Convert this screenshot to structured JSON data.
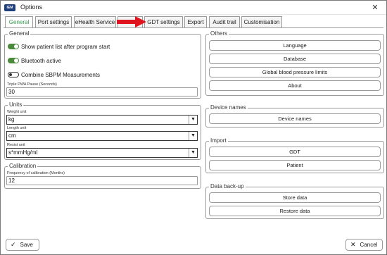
{
  "window": {
    "logo_text": "IEM",
    "title": "Options",
    "close_label": "✕"
  },
  "tabs": [
    {
      "label": "General"
    },
    {
      "label": "Port settings"
    },
    {
      "label": "eHealth Service"
    },
    {
      "label": ""
    },
    {
      "label": "GDT settings"
    },
    {
      "label": "Export"
    },
    {
      "label": "Audit trail"
    },
    {
      "label": "Customisation"
    }
  ],
  "general": {
    "label": "General",
    "toggles": [
      {
        "label": "Show patient list after program start",
        "on": true
      },
      {
        "label": "Bluetooth active",
        "on": true
      },
      {
        "label": "Combine SBPM Measurements",
        "on": false
      }
    ],
    "triple_pwa_label": "Triple PWA Pause (Seconds)",
    "triple_pwa_value": "30"
  },
  "units": {
    "label": "Units",
    "weight_label": "Weight unit",
    "weight_value": "kg",
    "length_label": "Length unit",
    "length_value": "cm",
    "resist_label": "Resist unit",
    "resist_value": "s*mmHg/ml"
  },
  "calibration": {
    "label": "Calibration",
    "freq_label": "Frequency of calibration (Months)",
    "freq_value": "12"
  },
  "others": {
    "label": "Others",
    "buttons": [
      "Language",
      "Database",
      "Global blood pressure limits",
      "About"
    ]
  },
  "device_names": {
    "label": "Device names",
    "button": "Device names"
  },
  "import": {
    "label": "Import",
    "buttons": [
      "GDT",
      "Patient"
    ]
  },
  "backup": {
    "label": "Data back-up",
    "buttons": [
      "Store data",
      "Restore data"
    ]
  },
  "footer": {
    "save": "Save",
    "cancel": "Cancel"
  },
  "colors": {
    "active_tab": "#2e9a4a",
    "toggle_on": "#4a8a3a",
    "arrow": "#e0141e"
  }
}
